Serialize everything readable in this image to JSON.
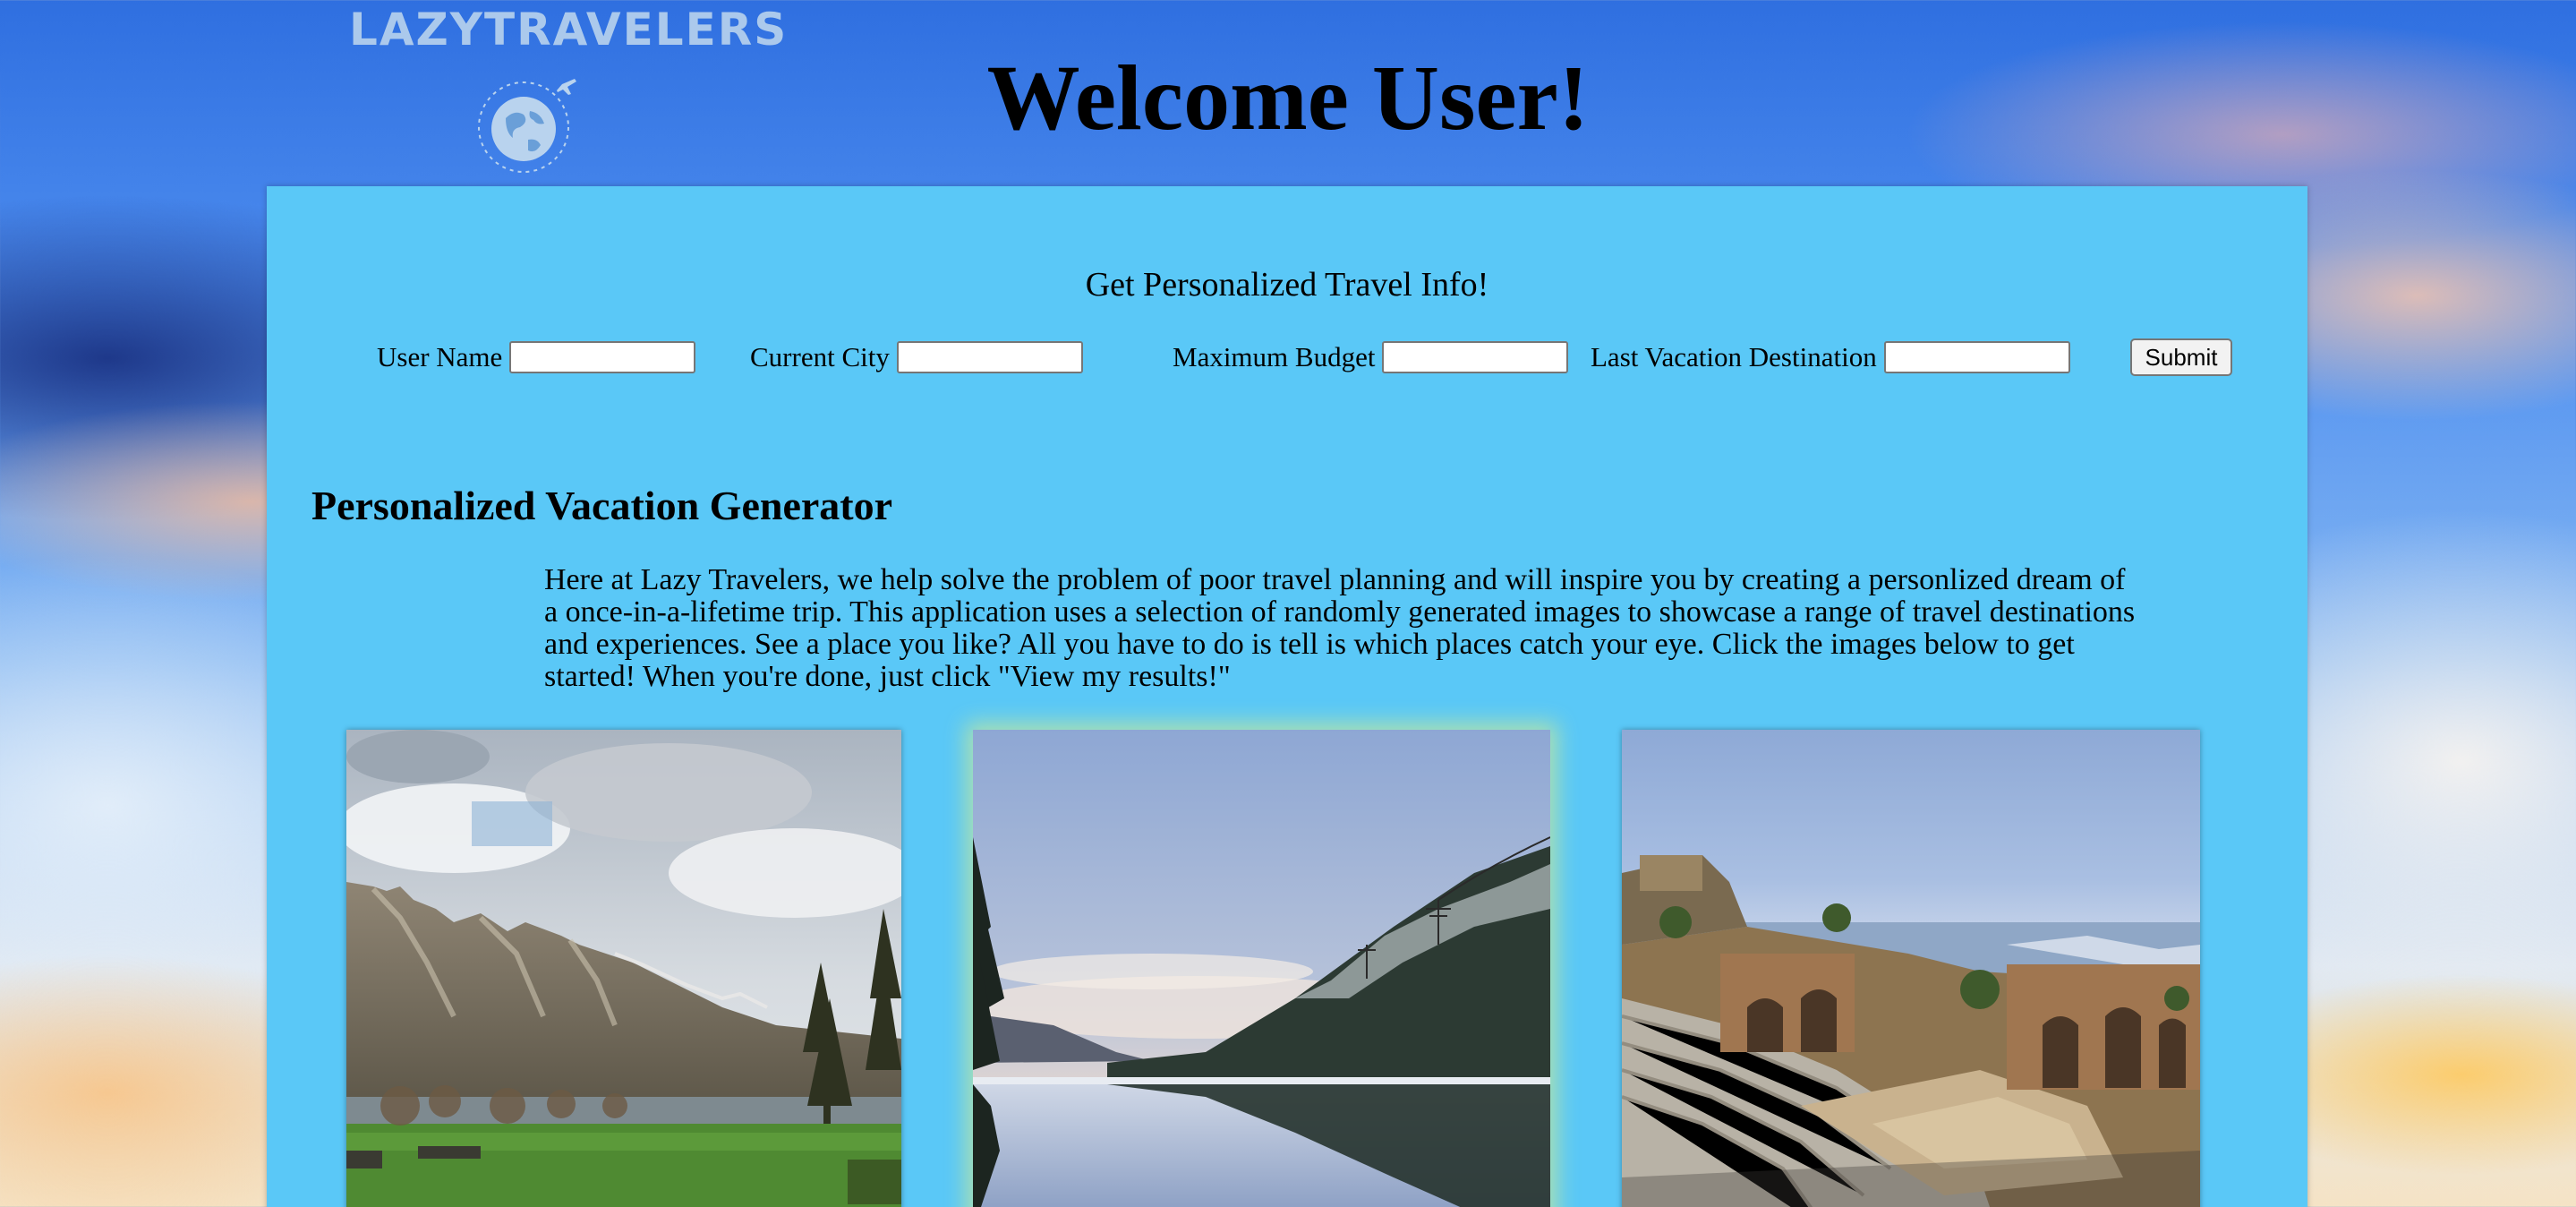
{
  "logo": {
    "text": "LAZYTRAVELERS",
    "icon": "globe-airplane-icon"
  },
  "header": {
    "title": "Welcome User!"
  },
  "form": {
    "title": "Get Personalized Travel Info!",
    "fields": [
      {
        "label": "User Name",
        "value": ""
      },
      {
        "label": "Current City",
        "value": ""
      },
      {
        "label": "Maximum Budget",
        "value": ""
      },
      {
        "label": "Last Vacation Destination",
        "value": ""
      }
    ],
    "submit_label": "Submit"
  },
  "generator": {
    "title": "Personalized Vacation Generator",
    "description": "Here at Lazy Travelers, we help solve the problem of poor travel planning and will inspire you by creating a personlized dream of a once-in-a-lifetime trip. This application uses a selection of randomly generated images to showcase a range of travel destinations and experiences. See a place you like? All you have to do is tell is which places catch your eye. Click the images below to get started! When you're done, just click \"View my results!\""
  },
  "gallery": {
    "images": [
      {
        "subject": "mountain-lake-meadow"
      },
      {
        "subject": "snowy-forest-lake-reflection"
      },
      {
        "subject": "ancient-greek-theater-ruins"
      }
    ]
  },
  "colors": {
    "panel": "#5ac8f7",
    "logo_text": "#b9d3ee",
    "highlight_glow": "#bee6a0"
  }
}
